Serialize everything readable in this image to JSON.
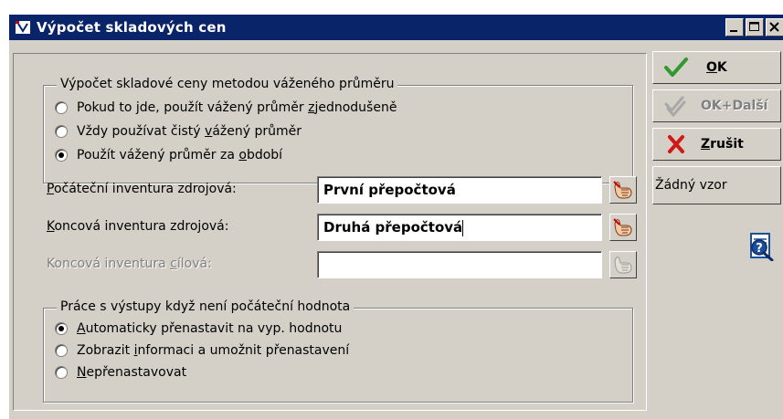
{
  "window": {
    "title": "Výpočet skladových cen",
    "controls": [
      "minimize",
      "maximize",
      "close"
    ]
  },
  "method_group": {
    "legend": "Výpočet skladové ceny metodou váženého průměru",
    "options": [
      {
        "pre": "Pokud to jde, použít vážený průměr ",
        "accel": "z",
        "post": "jednodušeně",
        "checked": false
      },
      {
        "pre": "Vždy používat čistý ",
        "accel": "v",
        "post": "ážený průměr",
        "checked": false
      },
      {
        "pre": "Použít vážený průměr za ",
        "accel": "o",
        "post": "bdobí",
        "checked": true
      }
    ]
  },
  "fields": {
    "start": {
      "label_accel": "P",
      "label_rest": "očáteční inventura zdrojová:",
      "value": "První přepočtová",
      "enabled": true
    },
    "end": {
      "label_accel": "K",
      "label_rest": "oncová inventura zdrojová:",
      "value": "Druhá přepočtová",
      "enabled": true
    },
    "target": {
      "label_pre": "Koncová inventura ",
      "label_accel": "c",
      "label_rest": "ílová:",
      "value": "",
      "enabled": false
    }
  },
  "output_group": {
    "legend": "Práce s výstupy když není počáteční hodnota",
    "options": [
      {
        "pre": "",
        "accel": "A",
        "post": "utomaticky přenastavit na vyp. hodnotu",
        "checked": true
      },
      {
        "pre": "Zobrazit ",
        "accel": "i",
        "post": "nformaci a umožnit přenastavení",
        "checked": false
      },
      {
        "pre": "",
        "accel": "N",
        "post": "epřenastavovat",
        "checked": false
      }
    ]
  },
  "buttons": {
    "ok": {
      "accel": "O",
      "rest": "K"
    },
    "ok_next": {
      "label": "OK+Další"
    },
    "cancel": {
      "accel": "Z",
      "rest": "rušit"
    },
    "template": {
      "label": "Žádný vzor"
    }
  },
  "colors": {
    "titlebar": "#0a246a",
    "face": "#d4d0c8",
    "ok_check": "#2e9a2e",
    "cancel_x": "#d01818"
  }
}
